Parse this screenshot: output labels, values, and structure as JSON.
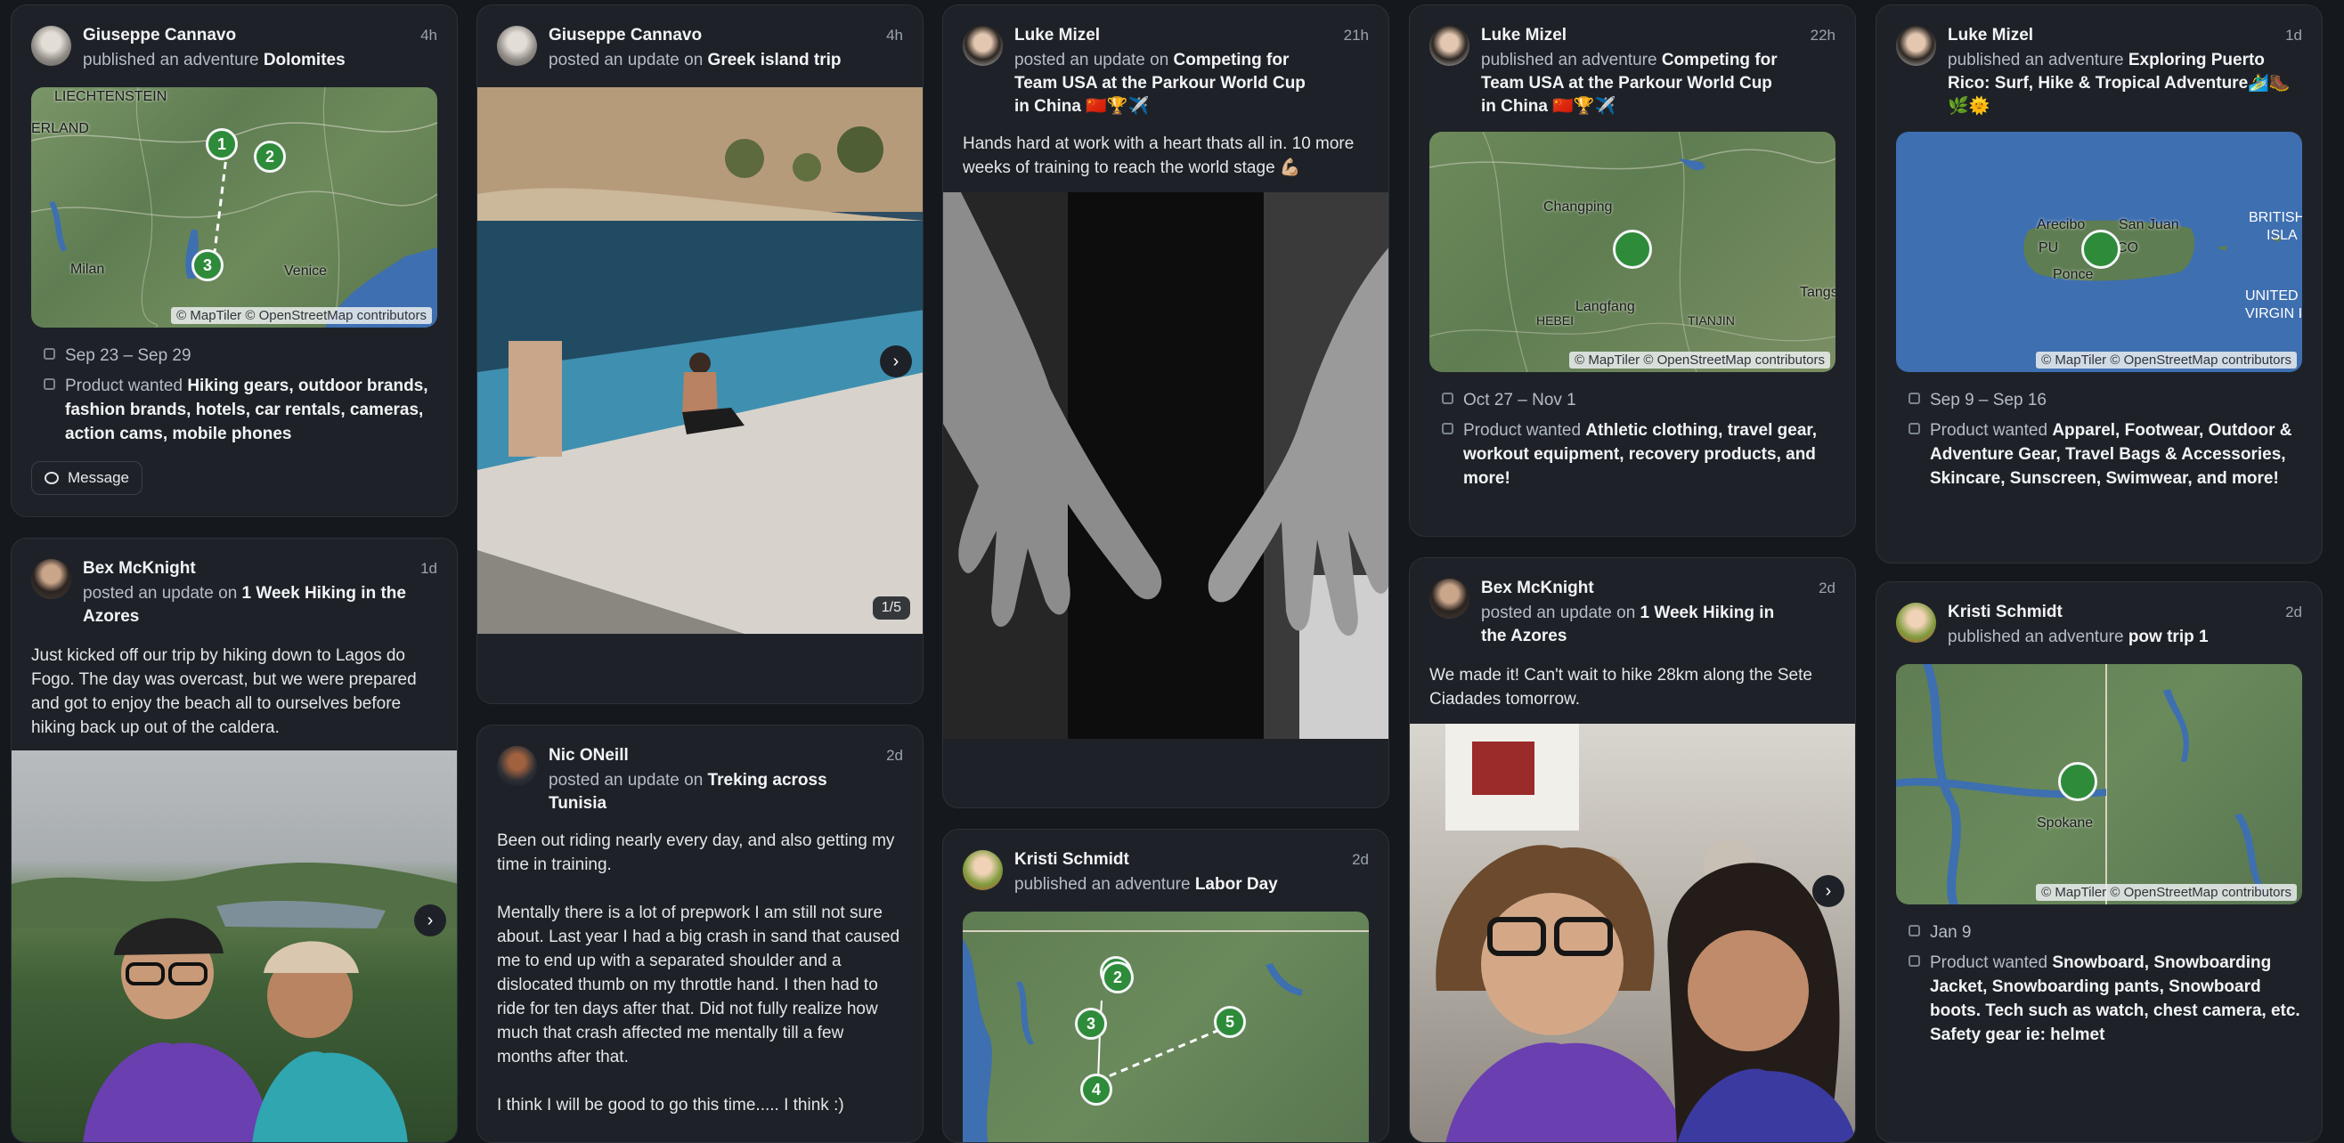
{
  "cards": {
    "c1": {
      "author": "Giuseppe Cannavo",
      "time": "4h",
      "verb": "published an adventure",
      "target": "Dolomites",
      "dates": "Sep 23 – Sep 29",
      "product_prefix": "Product wanted",
      "products": "Hiking gears, outdoor brands, fashion brands, hotels, car rentals, cameras, action cams, mobile phones",
      "message": "Message",
      "map_labels": [
        "LIECHTENSTEIN",
        "ERLAND",
        "Milan",
        "Venice"
      ],
      "pins": [
        "1",
        "2",
        "3"
      ],
      "attribution": "© MapTiler © OpenStreetMap contributors"
    },
    "c2": {
      "author": "Giuseppe Cannavo",
      "time": "4h",
      "verb": "posted an update on",
      "target": "Greek island trip",
      "counter": "1/5"
    },
    "c3": {
      "author": "Luke Mizel",
      "time": "21h",
      "verb": "posted an update on",
      "target": "Competing for Team USA at the Parkour World Cup in China 🇨🇳🏆✈️",
      "text": "Hands hard at work with a heart thats all in. 10 more weeks of training to reach the world stage 💪🏼"
    },
    "c4": {
      "author": "Luke Mizel",
      "time": "22h",
      "verb": "published an adventure",
      "target": "Competing for Team USA at the Parkour World Cup in China 🇨🇳🏆✈️",
      "dates": "Oct 27 – Nov 1",
      "product_prefix": "Product wanted",
      "products": "Athletic clothing, travel gear, workout equipment, recovery products, and more!",
      "map_labels": [
        "Changping",
        "Langfang",
        "HEBEI",
        "TIANJIN",
        "Tangs"
      ],
      "attribution": "© MapTiler © OpenStreetMap contributors"
    },
    "c5": {
      "author": "Luke Mizel",
      "time": "1d",
      "verb": "published an adventure",
      "target": "Exploring Puerto Rico: Surf, Hike & Tropical Adventure🏄‍♂️🥾🌿🌞",
      "dates": "Sep 9 – Sep 16",
      "product_prefix": "Product wanted",
      "products": "Apparel, Footwear, Outdoor & Adventure Gear, Travel Bags & Accessories, Skincare, Sunscreen, Swimwear, and more!",
      "map_labels": [
        "Arecibo",
        "San Juan",
        "PU",
        "RICO",
        "Ponce",
        "BRITISH",
        "ISLA",
        "UNITED ST",
        "VIRGIN ISL"
      ],
      "attribution": "© MapTiler © OpenStreetMap contributors"
    },
    "c6": {
      "author": "Bex McKnight",
      "time": "1d",
      "verb": "posted an update on",
      "target": "1 Week Hiking in the Azores",
      "text": "Just kicked off our trip by hiking down to Lagos do Fogo. The day was overcast, but we were prepared and got to enjoy the beach all to ourselves before hiking back up out of the caldera."
    },
    "c7": {
      "author": "Nic ONeill",
      "time": "2d",
      "verb": "posted an update on",
      "target": "Treking across Tunisia",
      "paragraphs": [
        "Been out riding nearly every day, and also getting my time in training.",
        "Mentally there is a lot of prepwork I am still not sure about. Last year I had a big crash in sand that caused me to end up with a separated shoulder and a dislocated thumb on my throttle hand. I then had to ride for ten days after that. Did not fully realize how much that crash affected me mentally till a few months after that.",
        "I think I will be good to go this time..... I think :)"
      ]
    },
    "c8": {
      "author": "Kristi Schmidt",
      "time": "2d",
      "verb": "published an adventure",
      "target": "Labor Day",
      "pins": [
        "2",
        "3",
        "4",
        "5"
      ]
    },
    "c9": {
      "author": "Bex McKnight",
      "time": "2d",
      "verb": "posted an update on",
      "target": "1 Week Hiking in the Azores",
      "text": "We made it! Can't wait to hike 28km along the Sete Ciadades tomorrow."
    },
    "c10": {
      "author": "Kristi Schmidt",
      "time": "2d",
      "verb": "published an adventure",
      "target": "pow trip 1",
      "dates": "Jan 9",
      "product_prefix": "Product wanted",
      "products": "Snowboard, Snowboarding Jacket, Snowboarding pants, Snowboard boots. Tech such as watch, chest camera, etc. Safety gear ie: helmet",
      "map_labels": [
        "Spokane"
      ],
      "attribution": "© MapTiler © OpenStreetMap contributors"
    }
  },
  "icons": {
    "next": "chevron-right-icon",
    "calendar": "calendar-icon",
    "product": "tag-icon",
    "message": "message-bubble-icon"
  },
  "colors": {
    "background": "#15181d",
    "card": "#1e2228",
    "pin": "#2e8b3a",
    "map_land": "#5f7d52",
    "map_water": "#3e6fb0"
  }
}
